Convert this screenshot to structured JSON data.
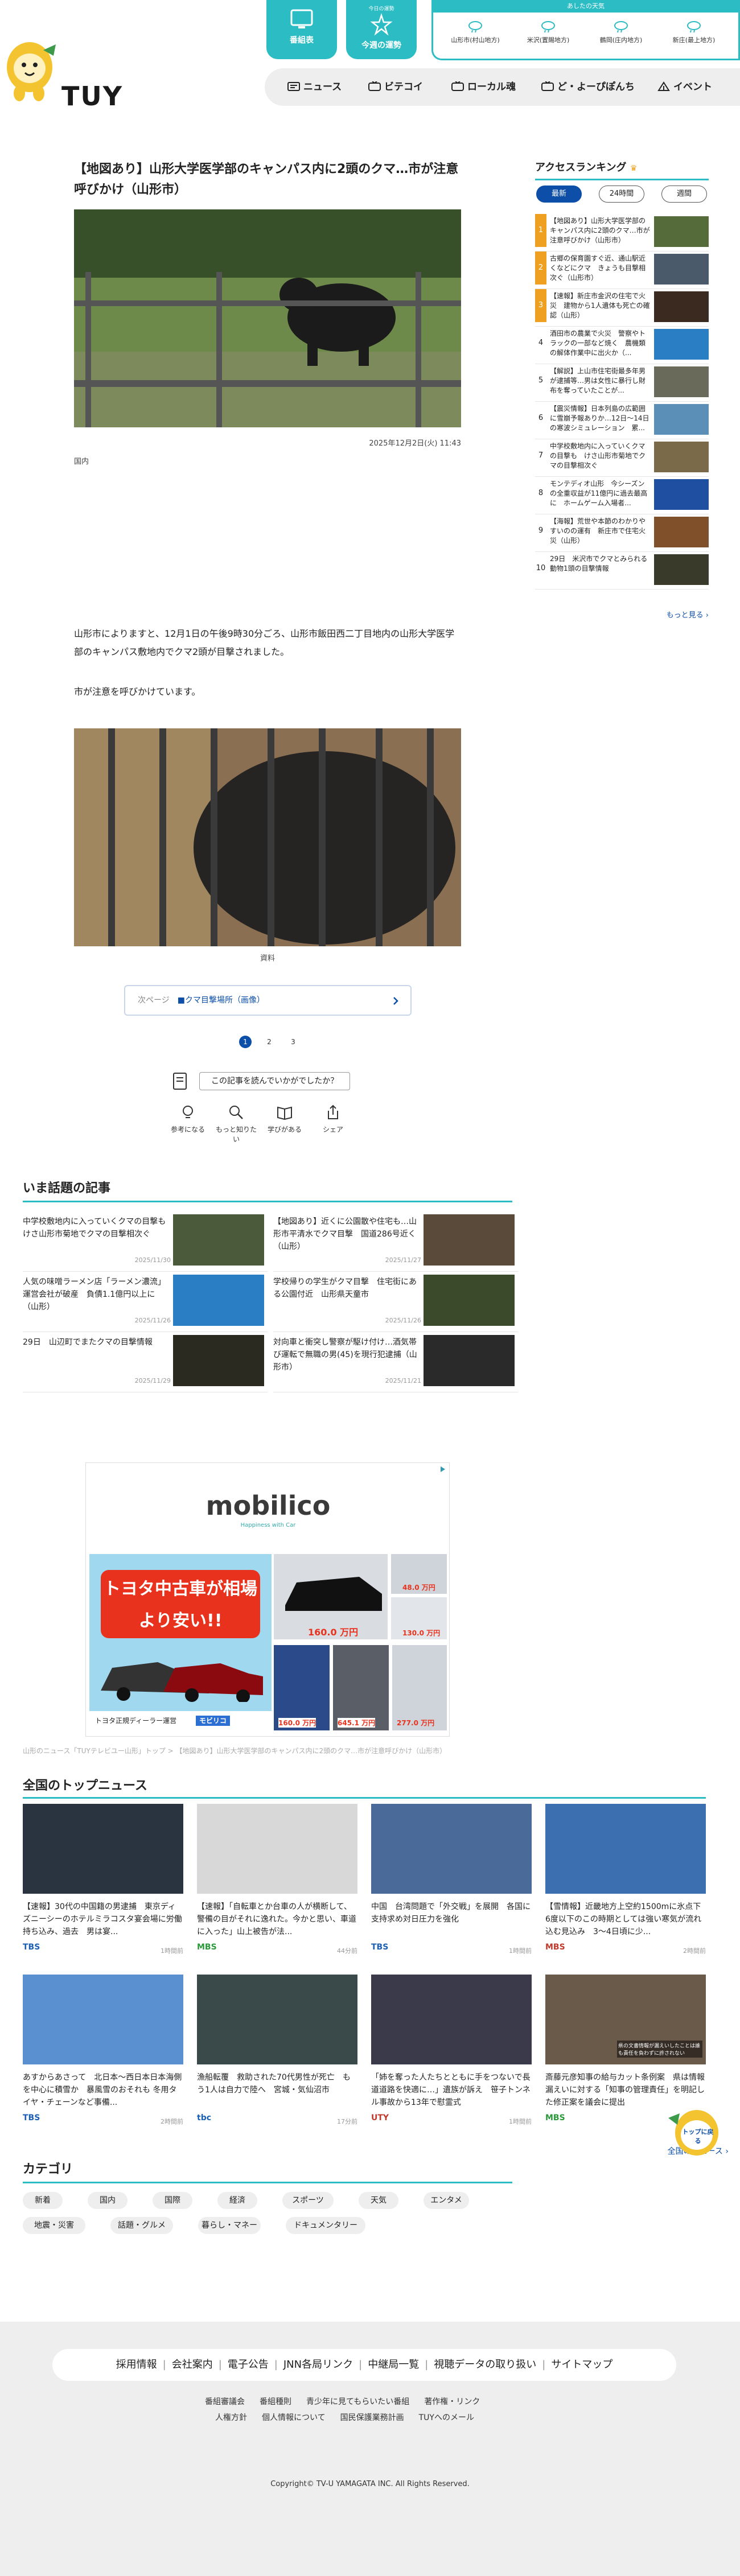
{
  "header": {
    "logo_text": "TUY",
    "buttons": [
      {
        "label": "番組表",
        "icon": "tv-guide-icon"
      },
      {
        "label": "今週の運勢",
        "icon": "fortune-icon",
        "badge": "今日の運勢"
      }
    ],
    "weather": {
      "title": "あしたの天気",
      "cities": [
        "山形市(村山地方)",
        "米沢(置賜地方)",
        "鶴岡(庄内地方)",
        "新庄(最上地方)"
      ]
    },
    "nav": [
      {
        "label": "ニュース",
        "icon": "news-icon"
      },
      {
        "label": "ビテコイ",
        "icon": "tv-icon"
      },
      {
        "label": "ローカル魂",
        "icon": "tv-icon"
      },
      {
        "label": "ど・よーぴぽんち",
        "icon": "tv-icon"
      },
      {
        "label": "イベント",
        "icon": "event-icon"
      }
    ]
  },
  "article": {
    "title": "【地図あり】山形大学医学部のキャンパス内に2頭のクマ…市が注意呼びかけ（山形市）",
    "date": "2025年12月2日(火) 11:43",
    "credit1": "国内",
    "body1": "山形市によりますと、12月1日の午後9時30分ごろ、山形市飯田西二丁目地内の山形大学医学部のキャンパス敷地内でクマ2頭が目撃されました。",
    "body2": "市が注意を呼びかけています。",
    "credit2": "資料",
    "next_label": "次ページ",
    "next_link": "■クマ目撃場所（画像）",
    "pages": [
      "1",
      "2",
      "3"
    ],
    "feedback_question": "この記事を読んでいかがでしたか？",
    "reactions": [
      {
        "label": "参考になる",
        "icon": "lightbulb-icon"
      },
      {
        "label": "もっと知りたい",
        "icon": "magnifier-icon"
      },
      {
        "label": "学びがある",
        "icon": "book-icon"
      },
      {
        "label": "シェア",
        "icon": "share-icon"
      }
    ]
  },
  "ranking": {
    "title": "アクセスランキング",
    "tabs": [
      "最新",
      "24時間",
      "週間"
    ],
    "items": [
      {
        "rank": "1",
        "text": "【地図あり】山形大学医学部のキャンパス内に2頭のクマ…市が注意呼びかけ（山形市）",
        "color": "#f0a020"
      },
      {
        "rank": "2",
        "text": "古郷の保育園すぐ近、通山駅近くなどにクマ　きょうも目撃相次ぐ（山形市）",
        "color": "#f0a020"
      },
      {
        "rank": "3",
        "text": "【速報】新庄市金沢の住宅で火災　建物から1人遺体も死亡の確認（山形）",
        "color": "#f0a020"
      },
      {
        "rank": "4",
        "text": "酒田市の農業で火災　警察やトラックの一部など焼く　農機類の解体作業中に出火か（...",
        "color": "#ffffff"
      },
      {
        "rank": "5",
        "text": "【解説】上山市住宅街最多年男が逮捕等…男は女性に暴行し財布を奪っていたことが...",
        "color": "#ffffff"
      },
      {
        "rank": "6",
        "text": "【震災情報】日本列島の広範囲に雪崩予報ありか…12日〜14日の寒波シミュレーション　累...",
        "color": "#ffffff"
      },
      {
        "rank": "7",
        "text": "中学校敷地内に入っていくクマの目撃も　けさ山形市菊地でクマの目撃相次ぐ",
        "color": "#ffffff"
      },
      {
        "rank": "8",
        "text": "モンテディオ山形　今シーズンの全重収益が11億円に過去最高に　ホームゲーム入場者...",
        "color": "#ffffff"
      },
      {
        "rank": "9",
        "text": "【海報】荒世や本節のわかりやすいのの運有　新庄市で住宅火災（山形）",
        "color": "#ffffff"
      },
      {
        "rank": "10",
        "text": "29日　米沢市でクマとみられる動物1頭の目撃情報",
        "color": "#ffffff"
      }
    ],
    "more": "もっと見る"
  },
  "trending": {
    "title": "いま話題の記事",
    "items": [
      {
        "text": "中学校敷地内に入っていくクマの目撃も　けさ山形市菊地でクマの目撃相次ぐ",
        "date": "2025/11/30"
      },
      {
        "text": "【地図あり】近くに公園散や住宅も…山形市平清水でクマ目撃　国道286号近く（山形）",
        "date": "2025/11/27"
      },
      {
        "text": "人気の味噌ラーメン店「ラーメン濃流」運営会社が破産　負債1.1億円以上に（山形）",
        "date": "2025/11/26"
      },
      {
        "text": "学校帰りの学生がクマ目撃　住宅街にある公園付近　山形県天童市",
        "date": "2025/11/26"
      },
      {
        "text": "29日　山辺町でまたクマの目撃情報",
        "date": "2025/11/29"
      },
      {
        "text": "対向車と衝突し警察が駆け付け…酒気帯び運転で無職の男(45)を現行犯逮捕（山形市）",
        "date": "2025/11/21"
      }
    ]
  },
  "ad": {
    "brand": "mobilico",
    "tagline": "Happiness with Car",
    "headline": "トヨタ中古車が相場より安い!!",
    "dealer": "トヨタ正規ディーラー運営",
    "brand_jp": "モビリコ",
    "prices": [
      "48.0 万円",
      "160.0 万円",
      "130.0 万円",
      "160.0 万円",
      "645.1 万円",
      "277.0 万円"
    ]
  },
  "breadcrumb": "山形のニュース「TUYテレビユー山形」トップ > 【地図あり】山形大学医学部のキャンパス内に2頭のクマ…市が注意呼びかけ（山形市）",
  "national": {
    "title": "全国のトップニュース",
    "items": [
      {
        "text": "【速報】30代の中国籍の男逮捕　東京ディズニーシーのホテルミラコスタ宴会場に労働持ち込み、過去　男は宴...",
        "source": "TBS",
        "date": "1時間前",
        "srccolor": "#1a5fb4"
      },
      {
        "text": "【速報】「自転車とか台車の人が横断して、警備の目がそれに逸れた。今かと思い、車道に入った」山上被告が法...",
        "source": "MBS",
        "date": "44分前",
        "srccolor": "#2a9a3a"
      },
      {
        "text": "中国　台湾問題で「外交戦」を展開　各国に支持求め対日圧力を強化",
        "source": "TBS",
        "date": "1時間前",
        "srccolor": "#1a5fb4"
      },
      {
        "text": "【雪情報】近畿地方上空約1500mに氷点下6度以下のこの時期としては強い寒気が流れ込む見込み　3〜4日頃に少...",
        "source": "MBS",
        "date": "2時間前",
        "srccolor": "#c0392b"
      },
      {
        "text": "あすからあさって　北日本〜西日本日本海側を中心に積雪か　暴風雪のおそれも 冬用タイヤ・チェーンなど事備...",
        "source": "TBS",
        "date": "2時間前",
        "srccolor": "#1a5fb4"
      },
      {
        "text": "漁船転覆　救助された70代男性が死亡　もう1人は自力で陸へ　宮城・気仙沼市",
        "source": "tbc",
        "date": "17分前",
        "srccolor": "#1a5fb4"
      },
      {
        "text": "「姉を奪った人たちとともに手をつないで長道道路を快適に…」遺族が訴え　笹子トンネル事故から13年で慰霊式",
        "source": "UTY",
        "date": "1時間前",
        "srccolor": "#c0392b"
      },
      {
        "text": "斎藤元彦知事の給与カット条例案　県は情報漏えいに対する「知事の管理責任」を明記した修正案を議会に提出",
        "source": "MBS",
        "date": "2時間前",
        "srccolor": "#2a9a3a"
      }
    ],
    "more": "全国のニュース",
    "photo_caption": "県の文書情報が漏えいしたことは誰も責任を負わずに許されない"
  },
  "categories": {
    "title": "カテゴリ",
    "items": [
      "新着",
      "国内",
      "国際",
      "経済",
      "スポーツ",
      "天気",
      "エンタメ",
      "地震・災害",
      "話題・グルメ",
      "暮らし・マネー",
      "ドキュメンタリー"
    ]
  },
  "footer": {
    "links": [
      "採用情報",
      "会社案内",
      "電子公告",
      "JNN各局リンク",
      "中継局一覧",
      "視聴データの取り扱い",
      "サイトマップ"
    ],
    "sub_row1": [
      "番組審議会",
      "番組種則",
      "青少年に見てもらいたい番組",
      "著作権・リンク"
    ],
    "sub_row2": [
      "人権方針",
      "個人情報について",
      "国民保護業務計画",
      "TUYへのメール"
    ],
    "copyright": "Copyright© TV-U YAMAGATA INC. All Rights Reserved."
  },
  "totop_label": "トップに戻る",
  "colors": {
    "accent": "#2bbcc4",
    "link": "#0c4ea8"
  }
}
